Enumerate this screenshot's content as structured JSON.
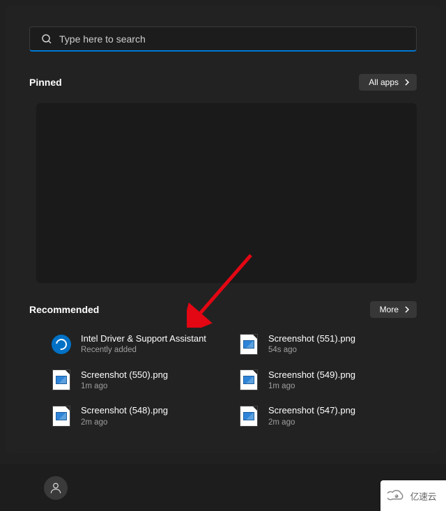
{
  "search": {
    "placeholder": "Type here to search"
  },
  "pinned": {
    "title": "Pinned",
    "all_apps_label": "All apps"
  },
  "recommended": {
    "title": "Recommended",
    "more_label": "More",
    "items": [
      {
        "title": "Intel Driver & Support Assistant",
        "sub": "Recently added",
        "icon": "intel"
      },
      {
        "title": "Screenshot (551).png",
        "sub": "54s ago",
        "icon": "image"
      },
      {
        "title": "Screenshot (550).png",
        "sub": "1m ago",
        "icon": "image"
      },
      {
        "title": "Screenshot (549).png",
        "sub": "1m ago",
        "icon": "image"
      },
      {
        "title": "Screenshot (548).png",
        "sub": "2m ago",
        "icon": "image"
      },
      {
        "title": "Screenshot (547).png",
        "sub": "2m ago",
        "icon": "image"
      }
    ]
  },
  "watermark": {
    "text": "亿速云"
  }
}
